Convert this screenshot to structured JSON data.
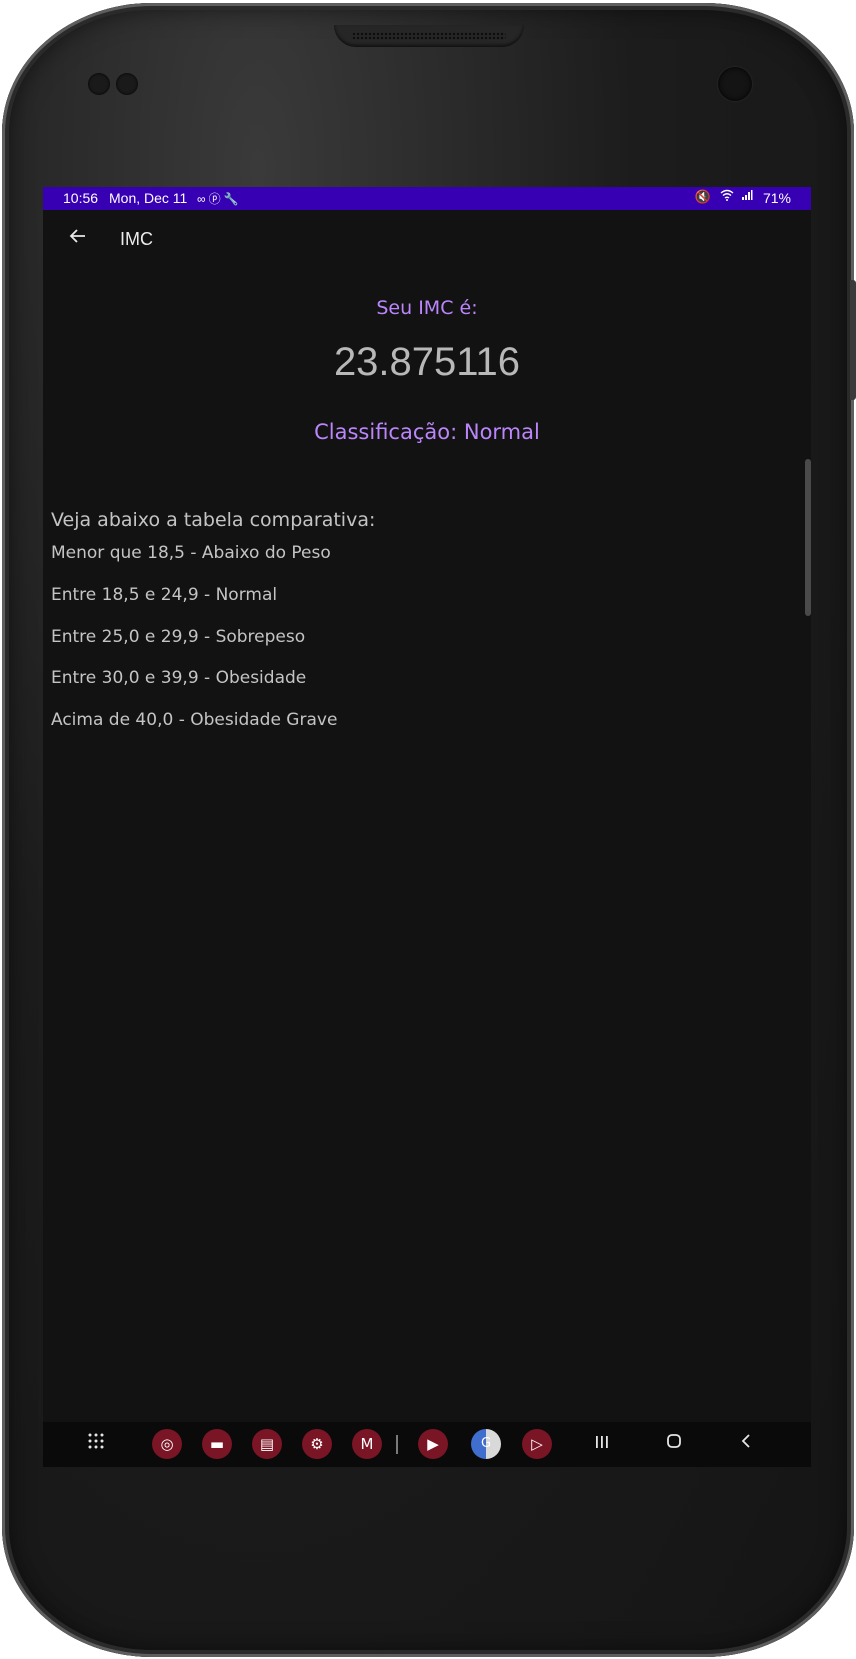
{
  "status_bar": {
    "time": "10:56",
    "date": "Mon, Dec 11",
    "left_icons": [
      "infinity-icon",
      "pinterest-icon",
      "wrench-icon"
    ],
    "right_icons": [
      "mute-icon",
      "wifi-icon",
      "signal-icon"
    ],
    "battery": "71%",
    "background_color": "#3700b3"
  },
  "app_bar": {
    "title": "IMC",
    "back_icon": "arrow-left-icon"
  },
  "result": {
    "label": "Seu IMC é:",
    "value": "23.875116",
    "classification": "Classificação: Normal",
    "accent_color": "#bb86fc"
  },
  "table": {
    "title": "Veja abaixo a tabela comparativa:",
    "rows": [
      "Menor que 18,5 - Abaixo do Peso",
      "Entre 18,5 e 24,9 - Normal",
      "Entre 25,0 e 29,9 - Sobrepeso",
      "Entre 30,0 e 39,9 - Obesidade",
      "Acima de 40,0 - Obesidade Grave"
    ]
  },
  "nav_bar": {
    "apps": [
      "apps-grid-icon",
      "chrome-icon",
      "files-icon",
      "notes-icon",
      "settings-icon",
      "gmail-icon",
      "youtube-icon",
      "google-translate-icon",
      "play-store-icon"
    ],
    "system_buttons": [
      "recents-icon",
      "home-icon",
      "back-icon"
    ]
  }
}
